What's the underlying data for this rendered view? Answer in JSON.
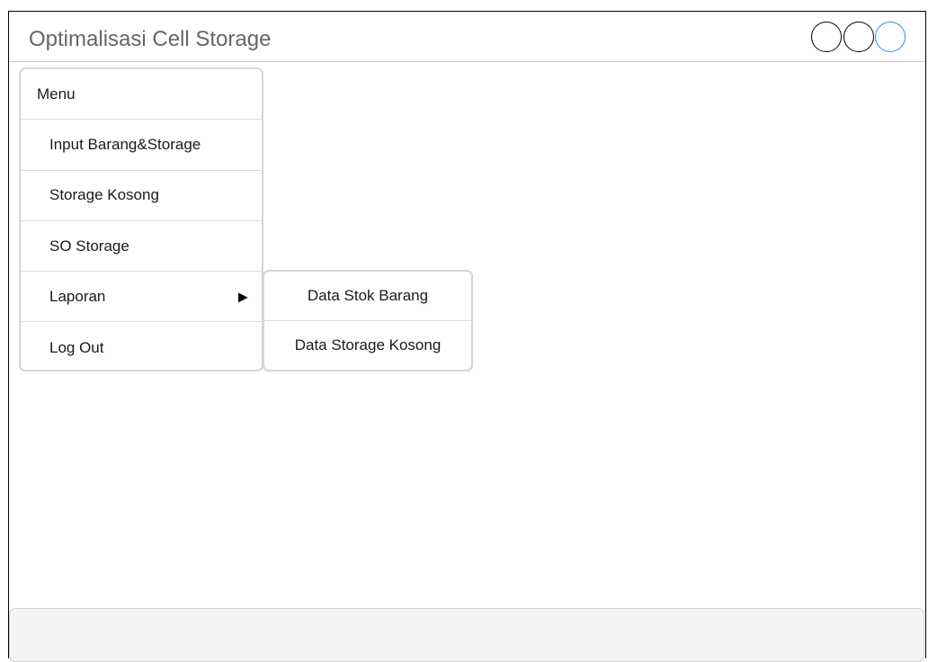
{
  "window": {
    "title": "Optimalisasi Cell Storage"
  },
  "window_controls": [
    {
      "name": "window-button-1",
      "accent": "#000000"
    },
    {
      "name": "window-button-2",
      "accent": "#000000"
    },
    {
      "name": "window-button-3",
      "accent": "#1e90ff"
    }
  ],
  "menu": {
    "header": "Menu",
    "items": [
      {
        "label": "Input Barang&Storage"
      },
      {
        "label": "Storage Kosong"
      },
      {
        "label": "SO Storage"
      },
      {
        "label": "Laporan",
        "has_submenu": true,
        "arrow": "▶"
      },
      {
        "label": "Log Out"
      }
    ]
  },
  "submenu": {
    "items": [
      {
        "label": "Data Stok Barang"
      },
      {
        "label": "Data Storage Kosong"
      }
    ]
  }
}
